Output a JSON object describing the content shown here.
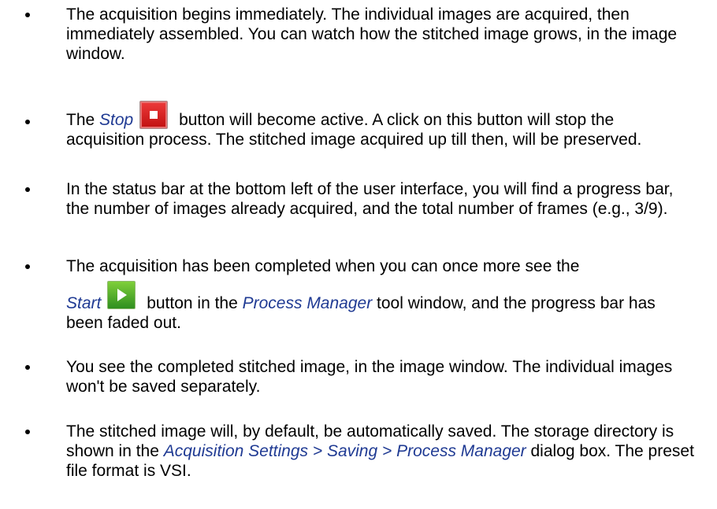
{
  "items": [
    {
      "text": "The acquisition begins immediately. The individual images are acquired, then immediately assembled. You can watch how the stitched image grows, in the image window."
    },
    {
      "pre": "The ",
      "em1": "Stop",
      "icon": "stop-icon",
      "post": " button will become active. A click on this button will stop the acquisition process. The stitched image acquired up till then, will be preserved."
    },
    {
      "text": "In the status bar at the bottom left of the user interface, you will find a progress bar, the number of images already acquired, and the total number of frames (e.g., 3/9)."
    },
    {
      "pre": "The acquisition has been completed when you can once more see the",
      "em1": "Start",
      "icon": "start-icon",
      "mid": " button in the ",
      "em2": "Process Manager",
      "post": " tool window, and the progress bar has been faded out."
    },
    {
      "text": "You see the completed stitched image, in the image window. The individual images won't be saved separately."
    },
    {
      "pre": "The stitched image will, by default, be automatically saved. The storage directory is shown in the ",
      "em1": "Acquisition Settings > Saving > Process Manager",
      "post": " dialog box. The preset file format is VSI."
    }
  ],
  "colors": {
    "emphasis": "#1f3a93",
    "stop_red": "#d42020",
    "start_green": "#4caf2f"
  }
}
